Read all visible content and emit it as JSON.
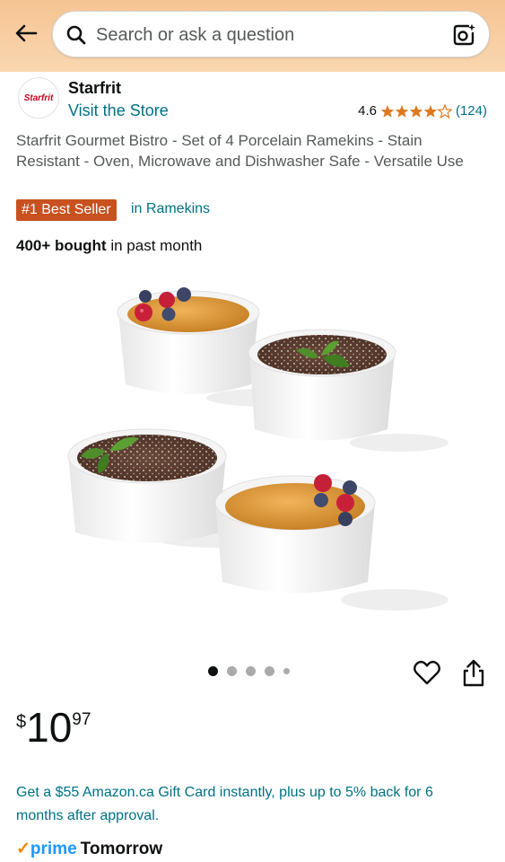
{
  "header": {
    "search_placeholder": "Search or ask a question",
    "back_icon": "arrow-left-icon",
    "search_icon": "magnifier-icon",
    "lens_icon": "camera-lens-icon"
  },
  "brand": {
    "logo_text": "Starfrit",
    "name": "Starfrit",
    "visit_store": "Visit the Store"
  },
  "rating": {
    "value": "4.6",
    "stars": 4.6,
    "count": "(124)"
  },
  "product": {
    "title": "Starfrit Gourmet Bistro - Set of 4 Porcelain Ramekins - Stain Resistant - Oven, Microwave and Dishwasher Safe - Versatile Use",
    "badge": "#1 Best Seller",
    "badge_category": "in Ramekins",
    "bought_strong": "400+ bought",
    "bought_rest": " in past month"
  },
  "gallery": {
    "total_images": 5,
    "active_index": 0
  },
  "price": {
    "symbol": "$",
    "whole": "10",
    "fraction": "97"
  },
  "offer": {
    "text": "Get a $55 Amazon.ca Gift Card instantly, plus up to 5% back for 6 months after approval."
  },
  "delivery": {
    "prime_label": "prime",
    "day": "Tomorrow"
  },
  "colors": {
    "link": "#007185",
    "badge": "#c7511f",
    "star": "#de7921",
    "prime": "#1a98ff",
    "header_bg": "#f6c492"
  }
}
